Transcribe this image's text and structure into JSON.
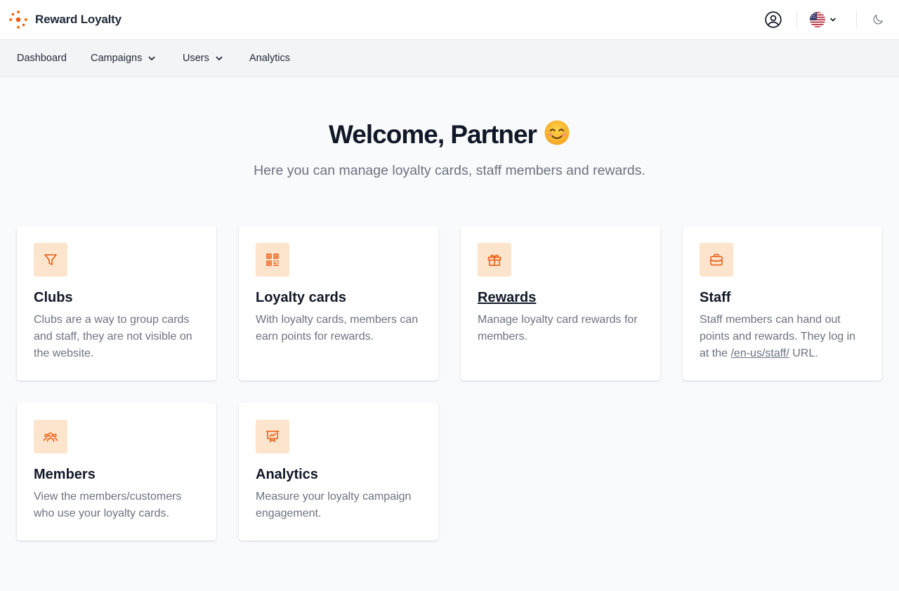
{
  "brand": {
    "name": "Reward Loyalty",
    "logo_icon": "dots-logo-icon",
    "accent_color": "#ea580c"
  },
  "header": {
    "user_icon": "user-circle-icon",
    "language_flag": "us-flag-icon",
    "theme_icon": "moon-icon"
  },
  "nav": {
    "items": [
      {
        "label": "Dashboard"
      },
      {
        "label": "Campaigns"
      },
      {
        "label": "Users"
      },
      {
        "label": "Analytics"
      }
    ]
  },
  "hero": {
    "title": "Welcome, Partner",
    "emoji": "😊",
    "subtitle": "Here you can manage loyalty cards, staff members and rewards."
  },
  "cards": [
    {
      "title": "Clubs",
      "icon": "funnel-icon",
      "description": "Clubs are a way to group cards and staff, they are not visible on the website."
    },
    {
      "title": "Loyalty cards",
      "icon": "qr-code-icon",
      "description": "With loyalty cards, members can earn points for rewards."
    },
    {
      "title": "Rewards",
      "icon": "gift-icon",
      "description": "Manage loyalty card rewards for members."
    },
    {
      "title": "Staff",
      "icon": "briefcase-icon",
      "description_before": "Staff members can hand out points and rewards. They log in at the ",
      "description_link": "/en-us/staff/",
      "description_after": " URL."
    },
    {
      "title": "Members",
      "icon": "users-icon",
      "description": "View the members/customers who use your loyalty cards."
    },
    {
      "title": "Analytics",
      "icon": "presentation-chart-icon",
      "description": "Measure your loyalty campaign engagement."
    }
  ],
  "colors": {
    "icon_bg": "#fde4cc",
    "icon_stroke": "#ea580c",
    "page_bg": "#f9fafb",
    "nav_bg": "#f3f4f6"
  }
}
